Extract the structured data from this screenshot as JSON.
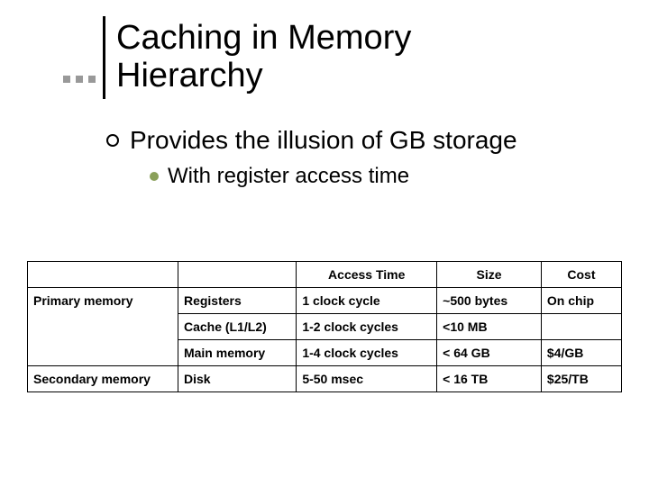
{
  "title_line1": "Caching in Memory",
  "title_line2": "Hierarchy",
  "bullet1": "Provides the illusion of GB storage",
  "bullet2": "With register access time",
  "disc_color": "#8aa05a",
  "table": {
    "headers": [
      "",
      "",
      "Access Time",
      "Size",
      "Cost"
    ],
    "categories": {
      "primary": "Primary memory",
      "secondary": "Secondary memory"
    },
    "rows": [
      {
        "label": "Registers",
        "access": "1 clock cycle",
        "size": "~500 bytes",
        "cost": "On chip"
      },
      {
        "label": "Cache (L1/L2)",
        "access": "1-2 clock cycles",
        "size": "<10 MB",
        "cost": ""
      },
      {
        "label": "Main memory",
        "access": "1-4 clock cycles",
        "size": "< 64 GB",
        "cost": "$4/GB"
      },
      {
        "label": "Disk",
        "access": "5-50 msec",
        "size": "< 16 TB",
        "cost": "$25/TB"
      }
    ]
  }
}
